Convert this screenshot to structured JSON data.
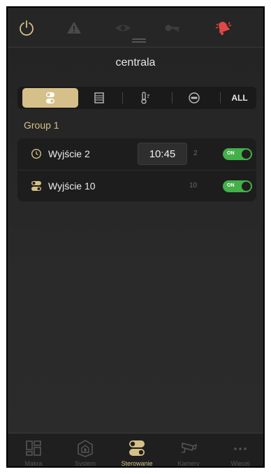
{
  "header": {
    "title": "centrala"
  },
  "filters": {
    "items": [
      {
        "name": "outputs",
        "active": true
      },
      {
        "name": "blinds",
        "active": false
      },
      {
        "name": "temperature",
        "active": false
      },
      {
        "name": "off",
        "active": false
      },
      {
        "name": "all",
        "label": "ALL",
        "active": false
      }
    ]
  },
  "group": {
    "label": "Group 1",
    "rows": [
      {
        "icon": "clock-icon",
        "label": "Wyjście 2",
        "time": "10:45",
        "number": "2",
        "toggle": "ON"
      },
      {
        "icon": "switch-icon",
        "label": "Wyjście 10",
        "number": "10",
        "toggle": "ON"
      }
    ]
  },
  "tabs": [
    {
      "label": "Makra",
      "icon": "macro-icon",
      "active": false
    },
    {
      "label": "System",
      "icon": "house-icon",
      "active": false
    },
    {
      "label": "Sterowanie",
      "icon": "switch-icon",
      "active": true
    },
    {
      "label": "Kamery",
      "icon": "camera-icon",
      "active": false
    },
    {
      "label": "Więcej",
      "icon": "more-icon",
      "active": false
    }
  ],
  "colors": {
    "accent": "#d6c089",
    "toggle_on": "#43b049",
    "alarm": "#e04848"
  }
}
